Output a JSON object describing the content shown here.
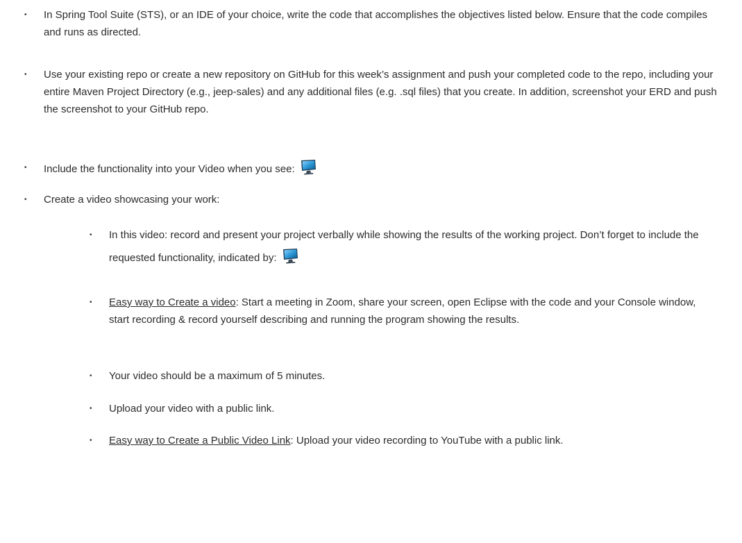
{
  "items": [
    {
      "text": "In Spring Tool Suite (STS), or an IDE of your choice, write the code that accomplishes the objectives listed below. Ensure that the code compiles and runs as directed."
    },
    {
      "text": "Use your existing repo or create a new repository on GitHub for this week’s assignment and push your completed code to the repo, including your entire Maven Project Directory (e.g., jeep-sales) and any additional files (e.g. .sql files) that you create.  In addition, screenshot your ERD and push the screenshot to your GitHub repo."
    },
    {
      "text": "Include the functionality into your Video when you see:",
      "icon": "monitor-icon"
    },
    {
      "text": "Create a video showcasing your work:"
    }
  ],
  "subitems": [
    {
      "text": "In this video: record and present your project verbally while showing the results of the working project.   Don’t forget to include the requested functionality, indicated by:",
      "icon": "monitor-icon"
    },
    {
      "link": "Easy way to Create a video",
      "text": ":  Start a meeting in Zoom, share your screen, open Eclipse with the code and your Console window, start recording & record yourself describing and running the program showing the results."
    },
    {
      "text": "Your video should be a maximum of 5 minutes."
    },
    {
      "text": "Upload your video with a public link."
    },
    {
      "link": "Easy way to Create a Public Video Link",
      "text": ":  Upload your video recording to YouTube with a public link."
    }
  ],
  "bullet_glyph": "•",
  "colors": {
    "text": "#2b2b2b",
    "monitor_screen": "#2e9ad8",
    "monitor_frame": "#1f3f5a"
  }
}
